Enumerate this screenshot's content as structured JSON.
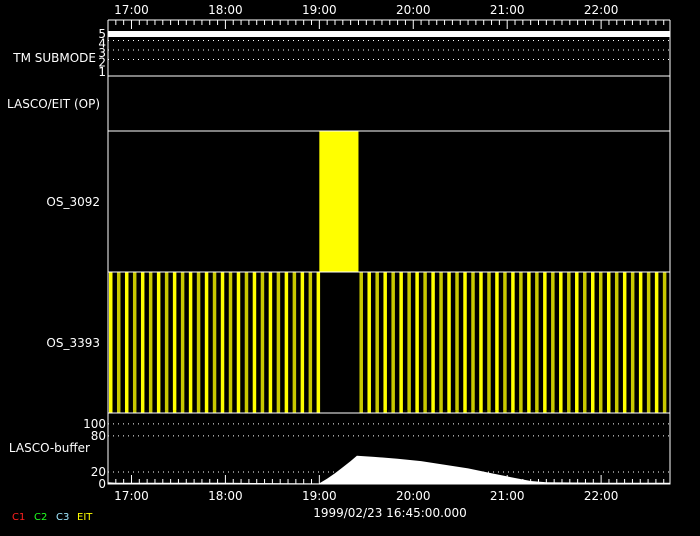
{
  "chart_data": {
    "type": "timeline",
    "x_axis": {
      "range": [
        "16:45",
        "22:44"
      ],
      "tick_labels": [
        "17:00",
        "18:00",
        "19:00",
        "20:00",
        "21:00",
        "22:00"
      ],
      "minor_tick_minutes": 5,
      "date_label": "1999/02/23 16:45:00.000"
    },
    "panels": [
      {
        "label": "TM SUBMODE",
        "type": "step",
        "ylim": [
          1,
          5
        ],
        "tick_labels": [
          "1",
          "2",
          "3",
          "4",
          "5"
        ],
        "grid": "dotted",
        "values": [
          [
            "16:45",
            5
          ],
          [
            "22:44",
            5
          ]
        ],
        "color": "#ffffff"
      },
      {
        "label": "LASCO/EIT (OP)",
        "type": "blocks",
        "blocks": []
      },
      {
        "label": "OS_3092",
        "type": "blocks",
        "color": "#ffff00",
        "blocks": [
          [
            "19:00",
            "19:25"
          ]
        ]
      },
      {
        "label": "OS_3393",
        "type": "stripes",
        "colors": [
          "#ffff00",
          "#c8c800"
        ],
        "cadence_minutes": 5.1,
        "active": [
          [
            "16:45",
            "19:00"
          ],
          [
            "19:25",
            "22:44"
          ]
        ]
      },
      {
        "label": "LASCO-buffer",
        "type": "area",
        "ylim": [
          0,
          118
        ],
        "tick_labels": [
          "0",
          "20",
          "80",
          "100"
        ],
        "grid_values": [
          20,
          80,
          100
        ],
        "color": "#ffffff",
        "values": [
          [
            "16:45",
            3
          ],
          [
            "16:50",
            2
          ],
          [
            "17:00",
            2
          ],
          [
            "18:00",
            2
          ],
          [
            "19:00",
            1
          ],
          [
            "19:05",
            9
          ],
          [
            "19:10",
            18
          ],
          [
            "19:15",
            28
          ],
          [
            "19:20",
            38
          ],
          [
            "19:24",
            47
          ],
          [
            "19:35",
            45
          ],
          [
            "19:50",
            42
          ],
          [
            "20:05",
            38
          ],
          [
            "20:20",
            32
          ],
          [
            "20:35",
            26
          ],
          [
            "20:50",
            18
          ],
          [
            "21:05",
            10
          ],
          [
            "21:15",
            5
          ],
          [
            "21:25",
            3
          ],
          [
            "22:00",
            2
          ],
          [
            "22:44",
            2
          ]
        ]
      }
    ],
    "legend": [
      {
        "label": "C1",
        "color": "#ff2020"
      },
      {
        "label": "C2",
        "color": "#20ff20"
      },
      {
        "label": "C3",
        "color": "#a0e8ff"
      },
      {
        "label": "EIT",
        "color": "#ffff00"
      }
    ]
  }
}
